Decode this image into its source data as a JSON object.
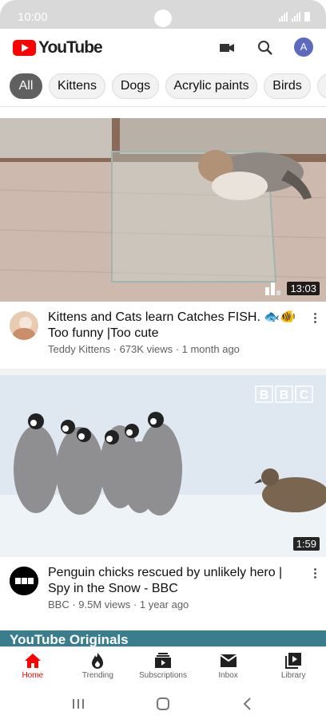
{
  "status_bar": {
    "time": "10:00"
  },
  "header": {
    "logo_text": "YouTube",
    "avatar_letter": "A"
  },
  "chips": [
    {
      "label": "All",
      "active": true
    },
    {
      "label": "Kittens"
    },
    {
      "label": "Dogs"
    },
    {
      "label": "Acrylic paints"
    },
    {
      "label": "Birds"
    }
  ],
  "videos": [
    {
      "title": "Kittens and Cats learn Catches FISH. 🐟🐠 Too funny |Too cute",
      "subtitle": "Teddy Kittens · 673K views · 1 month ago",
      "duration": "13:03"
    },
    {
      "title": "Penguin chicks rescued by unlikely hero | Spy in the Snow - BBC",
      "subtitle": "BBC · 9.5M views · 1 year ago",
      "duration": "1:59",
      "watermark": "BBC",
      "channel_logo": "BBC"
    }
  ],
  "partial_video": {
    "title_text": "YouTube Originals"
  },
  "bottom_nav": [
    {
      "label": "Home",
      "icon": "home-icon",
      "active": true
    },
    {
      "label": "Trending",
      "icon": "flame-icon"
    },
    {
      "label": "Subscriptions",
      "icon": "subscriptions-icon"
    },
    {
      "label": "Inbox",
      "icon": "mail-icon"
    },
    {
      "label": "Library",
      "icon": "library-icon"
    }
  ],
  "colors": {
    "brand": "#ff0000",
    "text": "#0f0f0f",
    "secondary": "#606060"
  }
}
